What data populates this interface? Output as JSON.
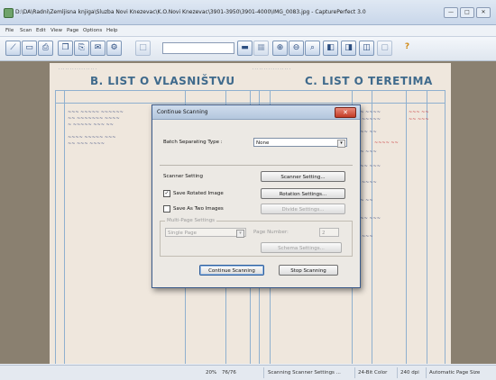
{
  "window": {
    "title": "D:\\DA\\Radni\\Zemljisna knjiga\\Sluzba Novi Knezevac\\K.O.Novi Knezevac\\3901-3950\\3901-4000\\IMG_0083.jpg - CapturePerfect 3.0",
    "min_label": "—",
    "max_label": "□",
    "close_label": "✕"
  },
  "menu": [
    "File",
    "Scan",
    "Edit",
    "View",
    "Page",
    "Options",
    "Help"
  ],
  "toolbar": {
    "icons": [
      "open-icon",
      "save-icon",
      "scan-icon",
      "copy-icon",
      "print-icon",
      "mail-icon",
      "fit-width-icon",
      "zoom-in-icon",
      "zoom-out-icon",
      "zoom-window-icon",
      "page-prev-icon",
      "page-next-icon",
      "rotate-icon",
      "help-icon"
    ],
    "help_glyph": "?"
  },
  "document": {
    "left_title": "B. LIST O VLASNIŠTVU",
    "right_title": "C. LIST O TERETIMA"
  },
  "dialog": {
    "title": "Continue Scanning",
    "batch_label": "Batch Separating Type :",
    "batch_value": "None",
    "scanner_setting_label": "Scanner Setting",
    "scanner_setting_button": "Scanner Setting...",
    "save_rotated_label": "Save Rotated Image",
    "save_rotated_checked": true,
    "rotation_button": "Rotation Settings...",
    "save_two_label": "Save As Two Images",
    "save_two_checked": false,
    "divide_button": "Divide Settings...",
    "multipage_label": "Multi-Page Settings",
    "page_mode_value": "Single Page",
    "page_number_label": "Page Number:",
    "page_number_value": "2",
    "schema_button": "Schema Settings...",
    "continue_button": "Continue Scanning",
    "stop_button": "Stop Scanning"
  },
  "status": {
    "zoom": "20%",
    "page": "76/76",
    "message": "Scanning Scanner Settings ...",
    "color": "24-Bit Color",
    "dpi": "240 dpi",
    "size": "Automatic Page Size"
  }
}
